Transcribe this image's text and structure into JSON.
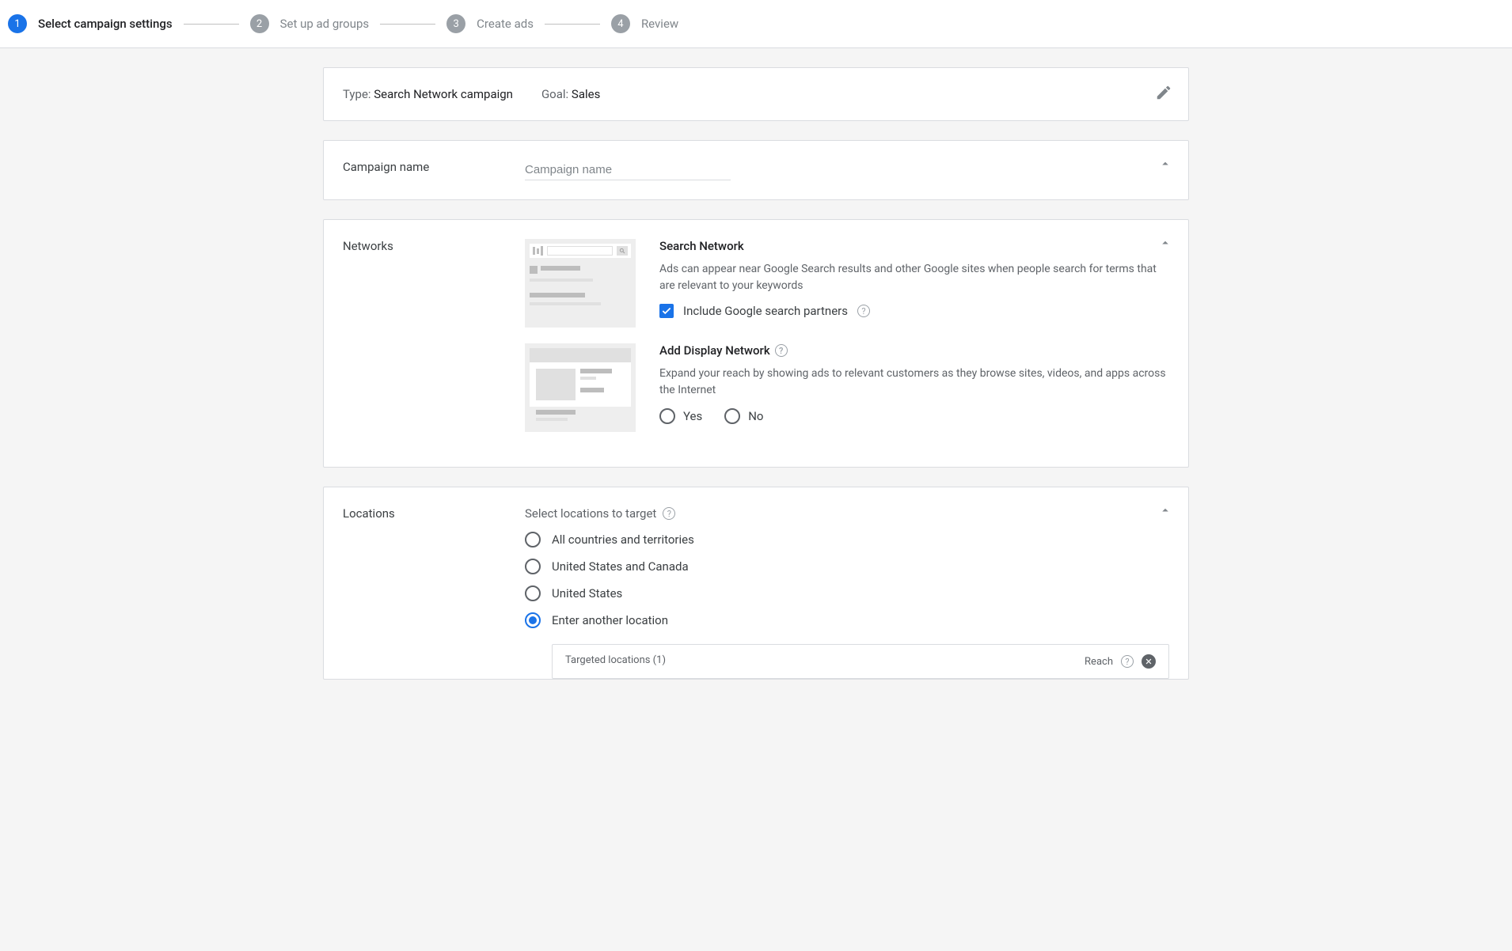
{
  "stepper": {
    "steps": [
      {
        "num": "1",
        "label": "Select campaign settings",
        "active": true
      },
      {
        "num": "2",
        "label": "Set up ad groups",
        "active": false
      },
      {
        "num": "3",
        "label": "Create ads",
        "active": false
      },
      {
        "num": "4",
        "label": "Review",
        "active": false
      }
    ]
  },
  "type_goal": {
    "type_key": "Type:",
    "type_val": "Search Network campaign",
    "goal_key": "Goal:",
    "goal_val": "Sales"
  },
  "campaign_name": {
    "label": "Campaign name",
    "placeholder": "Campaign name",
    "value": ""
  },
  "networks": {
    "label": "Networks",
    "search_network": {
      "title": "Search Network",
      "desc": "Ads can appear near Google Search results and other Google sites when people search for terms that are relevant to your keywords",
      "checkbox_label": "Include Google search partners",
      "checked": true
    },
    "display_network": {
      "title": "Add Display Network",
      "desc": "Expand your reach by showing ads to relevant customers as they browse sites, videos, and apps across the Internet",
      "yes": "Yes",
      "no": "No"
    }
  },
  "locations": {
    "label": "Locations",
    "header": "Select locations to target",
    "options": [
      {
        "label": "All countries and territories",
        "selected": false
      },
      {
        "label": "United States and Canada",
        "selected": false
      },
      {
        "label": "United States",
        "selected": false
      },
      {
        "label": "Enter another location",
        "selected": true
      }
    ],
    "targeted": {
      "header": "Targeted locations (1)",
      "reach": "Reach"
    }
  }
}
